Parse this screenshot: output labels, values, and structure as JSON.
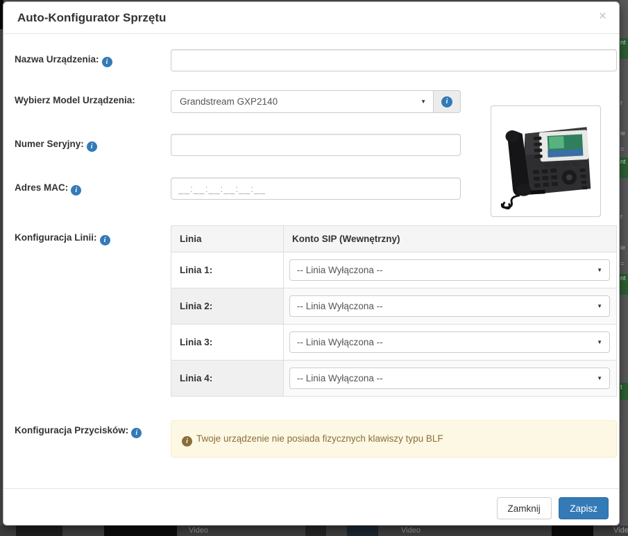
{
  "window": {
    "title": "Auto-Konfigurator Sprzętu",
    "close_icon": "×"
  },
  "icons": {
    "info": "i",
    "caret": "▼"
  },
  "form": {
    "device_name": {
      "label": "Nazwa Urządzenia:",
      "value": ""
    },
    "model": {
      "label": "Wybierz Model Urządzenia:",
      "selected": "Grandstream GXP2140"
    },
    "serial": {
      "label": "Numer Seryjny:",
      "value": ""
    },
    "mac": {
      "label": "Adres MAC:",
      "placeholder": "__:__:__:__:__:__"
    },
    "lines": {
      "label": "Konfiguracja Linii:"
    },
    "buttons_config": {
      "label": "Konfiguracja Przycisków:"
    }
  },
  "line_table": {
    "headers": [
      "Linia",
      "Konto SIP (Wewnętrzny)"
    ],
    "rows": [
      {
        "label": "Linia 1:",
        "selected": "-- Linia Wyłączona --"
      },
      {
        "label": "Linia 2:",
        "selected": "-- Linia Wyłączona --"
      },
      {
        "label": "Linia 3:",
        "selected": "-- Linia Wyłączona --"
      },
      {
        "label": "Linia 4:",
        "selected": "-- Linia Wyłączona --"
      }
    ]
  },
  "alert": {
    "text": "Twoje urządzenie nie posiada fizycznych klawiszy typu BLF"
  },
  "footer": {
    "close_label": "Zamknij",
    "save_label": "Zapisz"
  },
  "colors": {
    "primary": "#337ab7",
    "alert_bg": "#fcf8e3",
    "alert_text": "#8a6d3b",
    "bg_green": "#2d5f33"
  },
  "background": {
    "video_labels": [
      "Video",
      "Video",
      "Video"
    ],
    "green_fragments": [
      "nt",
      "nt",
      "nt",
      "t"
    ],
    "text_fragments": [
      "r",
      "ie",
      "=",
      "r",
      "ie",
      "="
    ]
  }
}
